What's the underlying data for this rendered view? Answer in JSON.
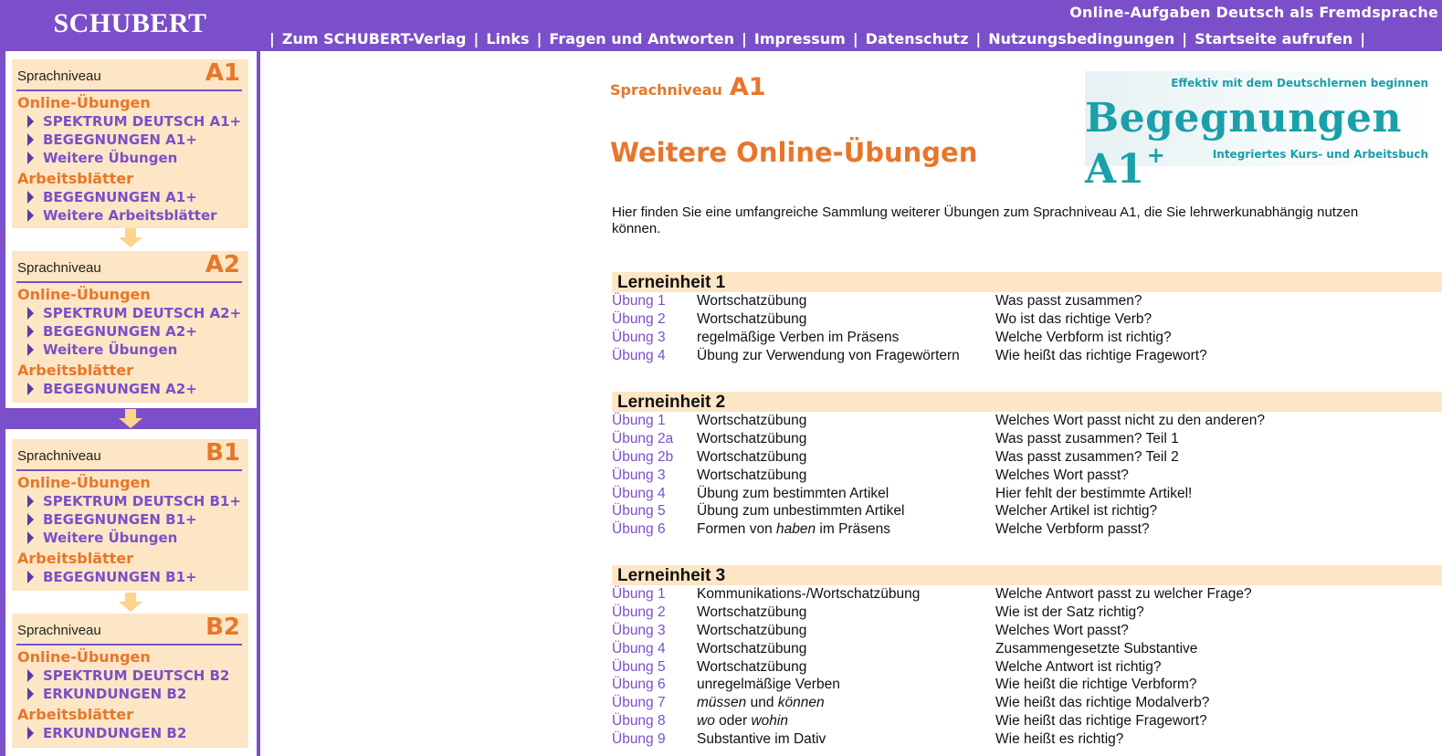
{
  "header": {
    "logo": "SCHUBERT",
    "tagline": "Online-Aufgaben Deutsch als Fremdsprache",
    "nav": [
      "Zum SCHUBERT-Verlag",
      "Links",
      "Fragen und Antworten",
      "Impressum",
      "Datenschutz",
      "Nutzungsbedingungen",
      "Startseite aufrufen"
    ],
    "separator": "|"
  },
  "sidebar": {
    "levels": [
      {
        "label": "Sprachniveau",
        "code": "A1",
        "online_title": "Online-Übungen",
        "online": [
          "SPEKTRUM DEUTSCH A1+",
          "BEGEGNUNGEN A1+",
          "Weitere Übungen"
        ],
        "sheets_title": "Arbeitsblätter",
        "sheets": [
          "BEGEGNUNGEN A1+",
          "Weitere Arbeitsblätter"
        ]
      },
      {
        "label": "Sprachniveau",
        "code": "A2",
        "online_title": "Online-Übungen",
        "online": [
          "SPEKTRUM DEUTSCH A2+",
          "BEGEGNUNGEN A2+",
          "Weitere Übungen"
        ],
        "sheets_title": "Arbeitsblätter",
        "sheets": [
          "BEGEGNUNGEN A2+"
        ]
      },
      {
        "label": "Sprachniveau",
        "code": "B1",
        "online_title": "Online-Übungen",
        "online": [
          "SPEKTRUM DEUTSCH B1+",
          "BEGEGNUNGEN B1+",
          "Weitere Übungen"
        ],
        "sheets_title": "Arbeitsblätter",
        "sheets": [
          "BEGEGNUNGEN B1+"
        ]
      },
      {
        "label": "Sprachniveau",
        "code": "B2",
        "online_title": "Online-Übungen",
        "online": [
          "SPEKTRUM DEUTSCH B2",
          "ERKUNDUNGEN B2"
        ],
        "sheets_title": "Arbeitsblätter",
        "sheets": [
          "ERKUNDUNGEN B2"
        ]
      }
    ]
  },
  "main": {
    "level_label": "Sprachniveau",
    "level_code": "A1",
    "title": "Weitere Online-Übungen",
    "intro": "Hier finden Sie eine umfangreiche Sammlung weiterer Übungen zum Sprachniveau A1, die Sie lehrwerkunabhängig nutzen können.",
    "banner": {
      "top": "Effektiv mit dem Deutschlernen beginnen",
      "main": "Begegnungen A1",
      "sup": "+",
      "bottom": "Integriertes Kurs- und Arbeitsbuch"
    },
    "units": [
      {
        "title": "Lerneinheit 1",
        "rows": [
          {
            "ex": "Übung 1",
            "topic": "Wortschatzübung",
            "question": "Was passt zusammen?"
          },
          {
            "ex": "Übung 2",
            "topic": "Wortschatzübung",
            "question": "Wo ist das richtige Verb?"
          },
          {
            "ex": "Übung 3",
            "topic": "regelmäßige Verben im Präsens",
            "question": "Welche Verbform ist richtig?"
          },
          {
            "ex": "Übung 4",
            "topic": "Übung zur Verwendung von Fragewörtern",
            "question": "Wie heißt das richtige Fragewort?"
          }
        ]
      },
      {
        "title": "Lerneinheit 2",
        "rows": [
          {
            "ex": "Übung 1",
            "topic": "Wortschatzübung",
            "question": "Welches Wort passt nicht zu den anderen?"
          },
          {
            "ex": "Übung 2a",
            "topic": "Wortschatzübung",
            "question": "Was passt zusammen? Teil 1"
          },
          {
            "ex": "Übung 2b",
            "topic": "Wortschatzübung",
            "question": "Was passt zusammen? Teil 2"
          },
          {
            "ex": "Übung 3",
            "topic": "Wortschatzübung",
            "question": "Welches Wort passt?"
          },
          {
            "ex": "Übung 4",
            "topic": "Übung zum bestimmten Artikel",
            "question": "Hier fehlt der bestimmte Artikel!"
          },
          {
            "ex": "Übung 5",
            "topic": "Übung zum unbestimmten Artikel",
            "question": "Welcher Artikel ist richtig?"
          },
          {
            "ex": "Übung 6",
            "topic_parts": [
              [
                "Formen von ",
                false
              ],
              [
                "haben",
                true
              ],
              [
                " im Präsens",
                false
              ]
            ],
            "question": "Welche Verbform passt?"
          }
        ]
      },
      {
        "title": "Lerneinheit 3",
        "rows": [
          {
            "ex": "Übung 1",
            "topic": "Kommunikations-/Wortschatzübung",
            "question": "Welche Antwort passt zu welcher Frage?"
          },
          {
            "ex": "Übung 2",
            "topic": "Wortschatzübung",
            "question": "Wie ist der Satz richtig?"
          },
          {
            "ex": "Übung 3",
            "topic": "Wortschatzübung",
            "question": "Welches Wort passt?"
          },
          {
            "ex": "Übung 4",
            "topic": "Wortschatzübung",
            "question": "Zusammengesetzte Substantive"
          },
          {
            "ex": "Übung 5",
            "topic": "Wortschatzübung",
            "question": "Welche Antwort ist richtig?"
          },
          {
            "ex": "Übung 6",
            "topic": "unregelmäßige Verben",
            "question": "Wie heißt die richtige Verbform?"
          },
          {
            "ex": "Übung 7",
            "topic_parts": [
              [
                "müssen",
                true
              ],
              [
                " und ",
                false
              ],
              [
                "können",
                true
              ]
            ],
            "question": "Wie heißt das richtige Modalverb?"
          },
          {
            "ex": "Übung 8",
            "topic_parts": [
              [
                "wo",
                true
              ],
              [
                " oder ",
                false
              ],
              [
                "wohin",
                true
              ]
            ],
            "question": "Wie heißt das richtige Fragewort?"
          },
          {
            "ex": "Übung 9",
            "topic": "Substantive im Dativ",
            "question": "Wie heißt es richtig?"
          }
        ]
      }
    ]
  }
}
